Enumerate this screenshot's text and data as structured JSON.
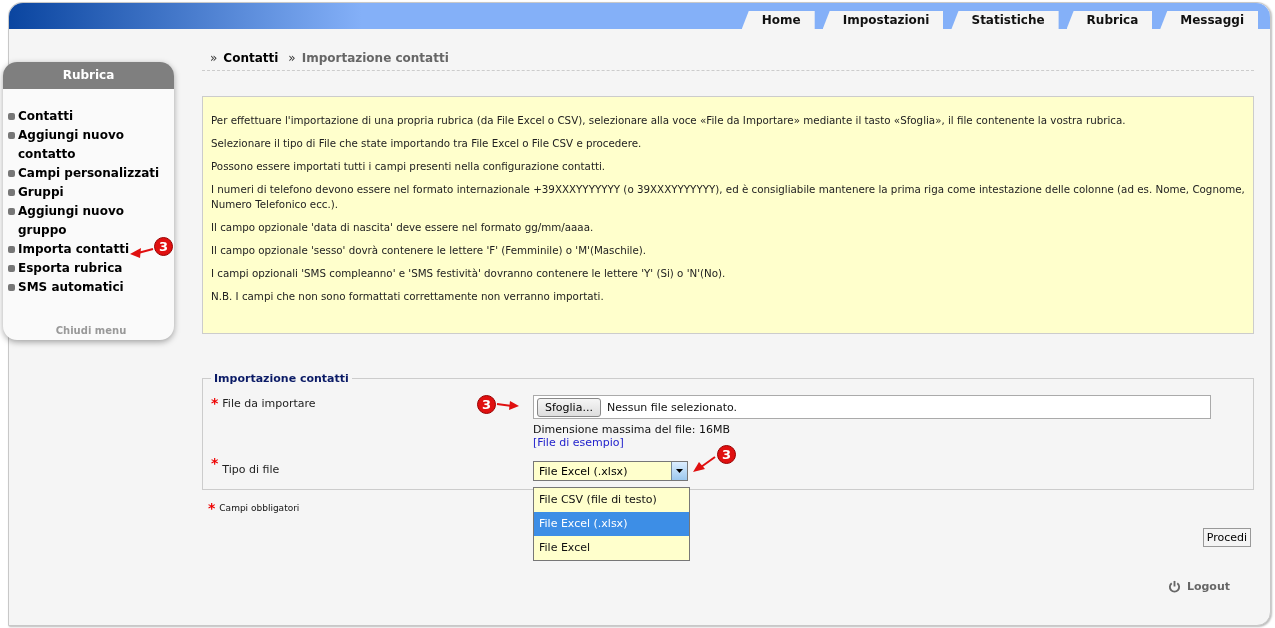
{
  "tabs": [
    {
      "label": "Home"
    },
    {
      "label": "Impostazioni"
    },
    {
      "label": "Statistiche"
    },
    {
      "label": "Rubrica"
    },
    {
      "label": "Messaggi"
    }
  ],
  "breadcrumb": {
    "separator": "»",
    "items": [
      "Contatti",
      "Importazione contatti"
    ]
  },
  "sidebar": {
    "title": "Rubrica",
    "items": [
      {
        "label": "Contatti"
      },
      {
        "label": "Aggiungi nuovo contatto"
      },
      {
        "label": "Campi personalizzati"
      },
      {
        "label": "Gruppi"
      },
      {
        "label": "Aggiungi nuovo gruppo"
      },
      {
        "label": "Importa contatti",
        "annotation": "3"
      },
      {
        "label": "Esporta rubrica"
      },
      {
        "label": "SMS automatici"
      }
    ],
    "footer": "Chiudi menu"
  },
  "info": [
    "Per effettuare l'importazione di una propria rubrica (da File Excel o CSV), selezionare alla voce «File da Importare» mediante il tasto «Sfoglia», il file contenente la vostra rubrica.",
    "Selezionare il tipo di File che state importando tra File Excel o File CSV e procedere.",
    "Possono essere importati tutti i campi presenti nella configurazione contatti.",
    "I numeri di telefono devono essere nel formato internazionale +39XXXYYYYYYY (o 39XXXYYYYYYY), ed è consigliabile mantenere la prima riga come intestazione delle colonne (ad es. Nome, Cognome, Numero Telefonico ecc.).",
    "Il campo opzionale 'data di nascita' deve essere nel formato gg/mm/aaaa.",
    "Il campo opzionale 'sesso' dovrà contenere le lettere 'F' (Femminile) o 'M'(Maschile).",
    "I campi opzionali 'SMS compleanno' e 'SMS festività' dovranno contenere le lettere 'Y' (Si) o 'N'(No).",
    "N.B. I campi che non sono formattati correttamente non verranno importati."
  ],
  "form": {
    "legend": "Importazione contatti",
    "file_field": {
      "mark": "*",
      "label": "File da importare",
      "button": "Sfoglia...",
      "status": "Nessun file selezionato.",
      "hint": "Dimensione massima del file: 16MB",
      "link": "[File di esempio]",
      "annotation": "3"
    },
    "type_field": {
      "mark": "*",
      "label": "Tipo di file",
      "value": "File Excel (.xlsx)",
      "expanded": true,
      "annotation": "3",
      "options": [
        {
          "label": "File CSV (file di testo)",
          "selected": false
        },
        {
          "label": "File Excel (.xlsx)",
          "selected": true
        },
        {
          "label": "File Excel",
          "selected": false
        }
      ]
    }
  },
  "required_note": {
    "mark": "*",
    "text": "Campi obbligatori"
  },
  "submit": "Procedi",
  "logout": "Logout"
}
